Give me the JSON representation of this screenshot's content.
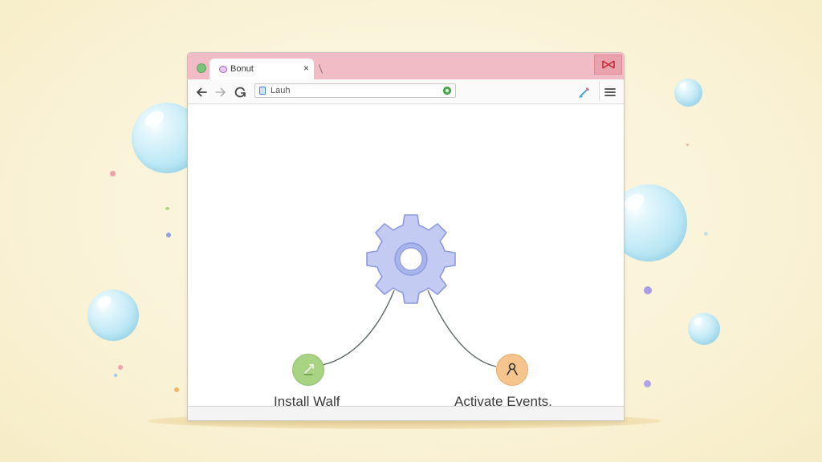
{
  "browser": {
    "tab": {
      "title": "Bonut",
      "close_label": "×"
    },
    "address_bar": {
      "text": "Lauh"
    }
  },
  "diagram": {
    "center_icon": "gear-icon",
    "left_node": {
      "label": "Install Walf",
      "icon": "wrench-icon",
      "color": "#a7d382"
    },
    "right_node": {
      "label": "Activate Events,",
      "icon": "pin-icon",
      "color": "#f6c58e"
    },
    "gear_color": "#c3cbf3"
  },
  "colors": {
    "titlebar": "#f1bcc6",
    "background": "#faf3d8",
    "bubble": "#bde8f5"
  }
}
